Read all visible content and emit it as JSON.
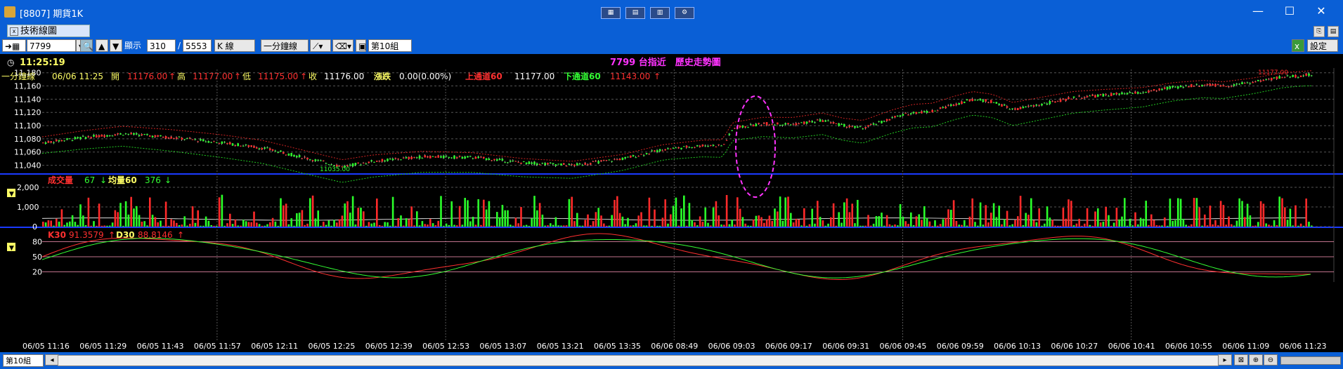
{
  "window": {
    "title": "[8807] 期貨1K",
    "min": "—",
    "max": "☐",
    "close": "✕"
  },
  "tab": {
    "label": "技術線圖",
    "close": "x"
  },
  "toolbar": {
    "symbol": "7799",
    "display_label": "顯示",
    "count_value": "310",
    "sep": "/",
    "total": "5553",
    "kline": "K 線",
    "period": "一分鐘線",
    "group": "第10組",
    "settings": "設定"
  },
  "chart": {
    "time": "11:25:19",
    "headline": "7799 台指近　歷史走勢圖",
    "info": {
      "period": "一分鐘線",
      "date": "06/06 11:25",
      "open_label": "開",
      "open": "11176.00",
      "high_label": "高",
      "high": "11177.00",
      "low_label": "低",
      "low": "11175.00",
      "close_label": "收",
      "close": "11176.00",
      "change_label": "漲跌",
      "change": "0.00(0.00%)",
      "upper_label": "上通道60",
      "upper": "11177.00",
      "lower_label": "下通道60",
      "lower": "11143.00"
    },
    "price_axis": {
      "ticks": [
        "11,180",
        "11,160",
        "11,140",
        "11,120",
        "11,100",
        "11,080",
        "11,060",
        "11,040"
      ],
      "values": [
        11180,
        11160,
        11140,
        11120,
        11100,
        11080,
        11060,
        11040
      ],
      "max_label": "11177.00",
      "min_label": "11035.00"
    },
    "volume": {
      "label": "成交量",
      "value": "67",
      "avg_label": "均量60",
      "avg": "376",
      "ticks": [
        "2,000",
        "1,000",
        "0"
      ],
      "tick_values": [
        2000,
        1000,
        0
      ]
    },
    "kd": {
      "k_label": "K30",
      "k": "91.3579",
      "d_label": "D30",
      "d": "88.8146",
      "ticks": [
        "80",
        "50",
        "20"
      ],
      "tick_values": [
        80,
        50,
        20
      ]
    },
    "x_labels": [
      "06/05 11:16",
      "06/05 11:29",
      "06/05 11:43",
      "06/05 11:57",
      "06/05 12:11",
      "06/05 12:25",
      "06/05 12:39",
      "06/05 12:53",
      "06/05 13:07",
      "06/05 13:21",
      "06/05 13:35",
      "06/06 08:49",
      "06/06 09:03",
      "06/06 09:17",
      "06/06 09:31",
      "06/06 09:45",
      "06/06 09:59",
      "06/06 10:13",
      "06/06 10:27",
      "06/06 10:41",
      "06/06 10:55",
      "06/06 11:09",
      "06/06 11:23"
    ]
  },
  "chart_data": {
    "type": "candlestick",
    "title": "7799 台指近　歷史走勢圖",
    "price_ylim": [
      11030,
      11185
    ],
    "price_path": [
      [
        0,
        11074
      ],
      [
        0.04,
        11082
      ],
      [
        0.08,
        11088
      ],
      [
        0.13,
        11082
      ],
      [
        0.18,
        11074
      ],
      [
        0.22,
        11066
      ],
      [
        0.26,
        11052
      ],
      [
        0.3,
        11038
      ],
      [
        0.33,
        11046
      ],
      [
        0.38,
        11053
      ],
      [
        0.43,
        11052
      ],
      [
        0.48,
        11044
      ],
      [
        0.53,
        11040
      ],
      [
        0.58,
        11050
      ],
      [
        0.62,
        11064
      ],
      [
        0.66,
        11070
      ],
      [
        0.68,
        11070
      ],
      [
        0.69,
        11096
      ],
      [
        0.72,
        11103
      ],
      [
        0.75,
        11102
      ],
      [
        0.78,
        11108
      ],
      [
        0.8,
        11100
      ],
      [
        0.82,
        11096
      ],
      [
        0.85,
        11112
      ],
      [
        0.87,
        11120
      ],
      [
        0.89,
        11122
      ],
      [
        0.91,
        11132
      ],
      [
        0.93,
        11140
      ],
      [
        0.95,
        11136
      ],
      [
        0.97,
        11124
      ],
      [
        0.99,
        11130
      ],
      [
        1.01,
        11136
      ],
      [
        1.03,
        11142
      ],
      [
        1.06,
        11146
      ],
      [
        1.1,
        11150
      ],
      [
        1.13,
        11158
      ],
      [
        1.16,
        11162
      ],
      [
        1.18,
        11160
      ],
      [
        1.21,
        11166
      ],
      [
        1.24,
        11174
      ],
      [
        1.27,
        11177
      ]
    ],
    "volume_ylim": [
      0,
      2500
    ],
    "kd_ylim": [
      0,
      100
    ]
  }
}
